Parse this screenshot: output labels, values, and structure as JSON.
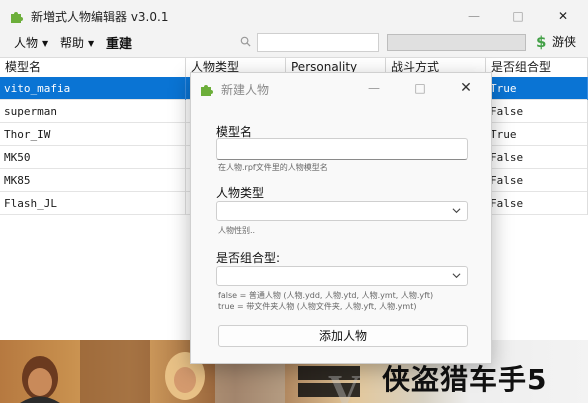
{
  "window": {
    "title": "新増式人物编辑器 v3.0.1"
  },
  "toolbar": {
    "menu_people": "人物",
    "menu_help": "帮助",
    "new_label": "重建",
    "search_value": "",
    "game_label": "游侠"
  },
  "table": {
    "headers": [
      "模型名",
      "人物类型",
      "Personality",
      "战斗方式",
      "是否组合型"
    ],
    "rows": [
      {
        "model": "vito_mafia",
        "type": "",
        "personality": "",
        "combat": "",
        "combo": "True",
        "selected": true
      },
      {
        "model": "superman",
        "type": "",
        "personality": "",
        "combat": "",
        "combo": "False",
        "selected": false
      },
      {
        "model": "Thor_IW",
        "type": "",
        "personality": "",
        "combat": "",
        "combo": "True",
        "selected": false
      },
      {
        "model": "MK50",
        "type": "",
        "personality": "",
        "combat": "",
        "combo": "False",
        "selected": false
      },
      {
        "model": "MK85",
        "type": "",
        "personality": "",
        "combat": "",
        "combo": "False",
        "selected": false
      },
      {
        "model": "Flash_JL",
        "type": "",
        "personality": "",
        "combat": "",
        "combo": "False",
        "selected": false
      }
    ]
  },
  "banner": {
    "text": "侠盗猎车手5"
  },
  "dialog": {
    "title": "新建人物",
    "model_label": "模型名",
    "model_value": "",
    "model_hint": "在人物.rpf文件里的人物模型名",
    "type_label": "人物类型",
    "type_value": "",
    "type_hint": "人物性别..",
    "combo_label": "是否组合型:",
    "combo_value": "",
    "combo_hint_1": "false = 普通人物 (人物.ydd, 人物.ytd, 人物.ymt, 人物.yft)",
    "combo_hint_2": "true = 带文件夹人物 (人物文件夹, 人物.yft, 人物.ymt)",
    "add_button": "添加人物"
  },
  "colors": {
    "selection": "#0a74d4",
    "accent_green": "#43a047"
  }
}
